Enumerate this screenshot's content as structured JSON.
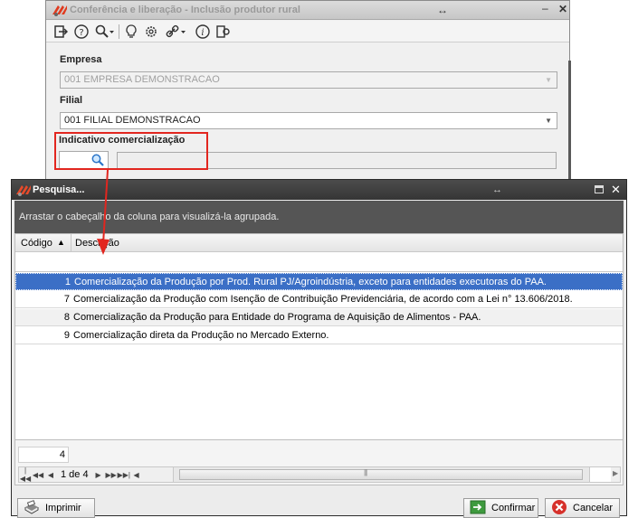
{
  "back_window": {
    "title": "Conferência e liberação - Inclusão produtor rural",
    "toolbar_icons": [
      "exit-icon",
      "help-icon",
      "search-icon",
      "bulb-icon",
      "gear-icon",
      "link-icon",
      "info-icon",
      "export-icon"
    ],
    "empresa": {
      "label": "Empresa",
      "value": "001 EMPRESA DEMONSTRACAO"
    },
    "filial": {
      "label": "Filial",
      "value": "001 FILIAL DEMONSTRACAO"
    },
    "indicativo": {
      "label": "Indicativo comercialização"
    }
  },
  "dialog": {
    "title": "Pesquisa...",
    "group_hint": "Arrastar o cabeçalho da coluna para visualizá-la agrupada.",
    "columns": [
      "Código",
      "Descrição"
    ],
    "rows": [
      {
        "code": "1",
        "description": "Comercialização da Produção por Prod. Rural PJ/Agroindústria, exceto para entidades executoras do PAA."
      },
      {
        "code": "7",
        "description": "Comercialização da Produção com Isenção de Contribuição Previdenciária, de acordo com a Lei n° 13.606/2018."
      },
      {
        "code": "8",
        "description": "Comercialização da Produção para Entidade do Programa de Aquisição de Alimentos - PAA."
      },
      {
        "code": "9",
        "description": "Comercialização direta da Produção no Mercado Externo."
      }
    ],
    "selected_row": 0,
    "record_count": "4",
    "pager_text": "1 de 4",
    "buttons": {
      "print": "Imprimir",
      "confirm": "Confirmar",
      "cancel": "Cancelar"
    }
  },
  "colors": {
    "highlight": "#e2261f",
    "selection": "#3b6fc6",
    "dialog_title": "#3c3c3c"
  }
}
